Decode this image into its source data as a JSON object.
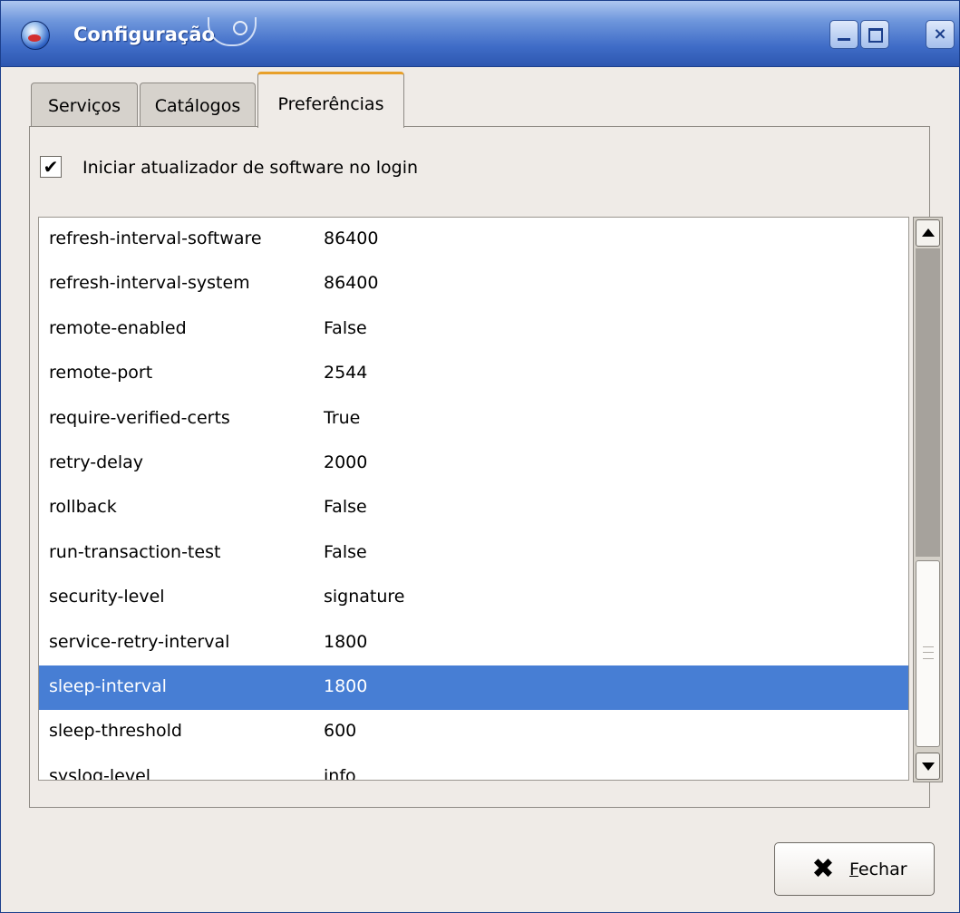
{
  "window": {
    "title": "Configuração",
    "controls": {
      "close": "×"
    }
  },
  "tabs": [
    {
      "label": "Serviços",
      "active": false
    },
    {
      "label": "Catálogos",
      "active": false
    },
    {
      "label": "Preferências",
      "active": true
    }
  ],
  "preferences": {
    "startup_checkbox": {
      "label": "Iniciar atualizador de software no login",
      "checked": true,
      "mark": "✔"
    },
    "rows": [
      {
        "key": "refresh-interval-software",
        "value": "86400"
      },
      {
        "key": "refresh-interval-system",
        "value": "86400"
      },
      {
        "key": "remote-enabled",
        "value": "False"
      },
      {
        "key": "remote-port",
        "value": "2544"
      },
      {
        "key": "require-verified-certs",
        "value": "True"
      },
      {
        "key": "retry-delay",
        "value": "2000"
      },
      {
        "key": "rollback",
        "value": "False"
      },
      {
        "key": "run-transaction-test",
        "value": "False"
      },
      {
        "key": "security-level",
        "value": "signature"
      },
      {
        "key": "service-retry-interval",
        "value": "1800"
      },
      {
        "key": "sleep-interval",
        "value": "1800",
        "selected": true
      },
      {
        "key": "sleep-threshold",
        "value": "600"
      },
      {
        "key": "syslog-level",
        "value": "info"
      }
    ]
  },
  "footer": {
    "close_button": {
      "icon": "✖",
      "mnemonic": "F",
      "label_rest": "echar"
    }
  },
  "colors": {
    "selection": "#477ed4",
    "titlebar": "#3f6cc7",
    "active_tab_accent": "#e8a02a"
  }
}
